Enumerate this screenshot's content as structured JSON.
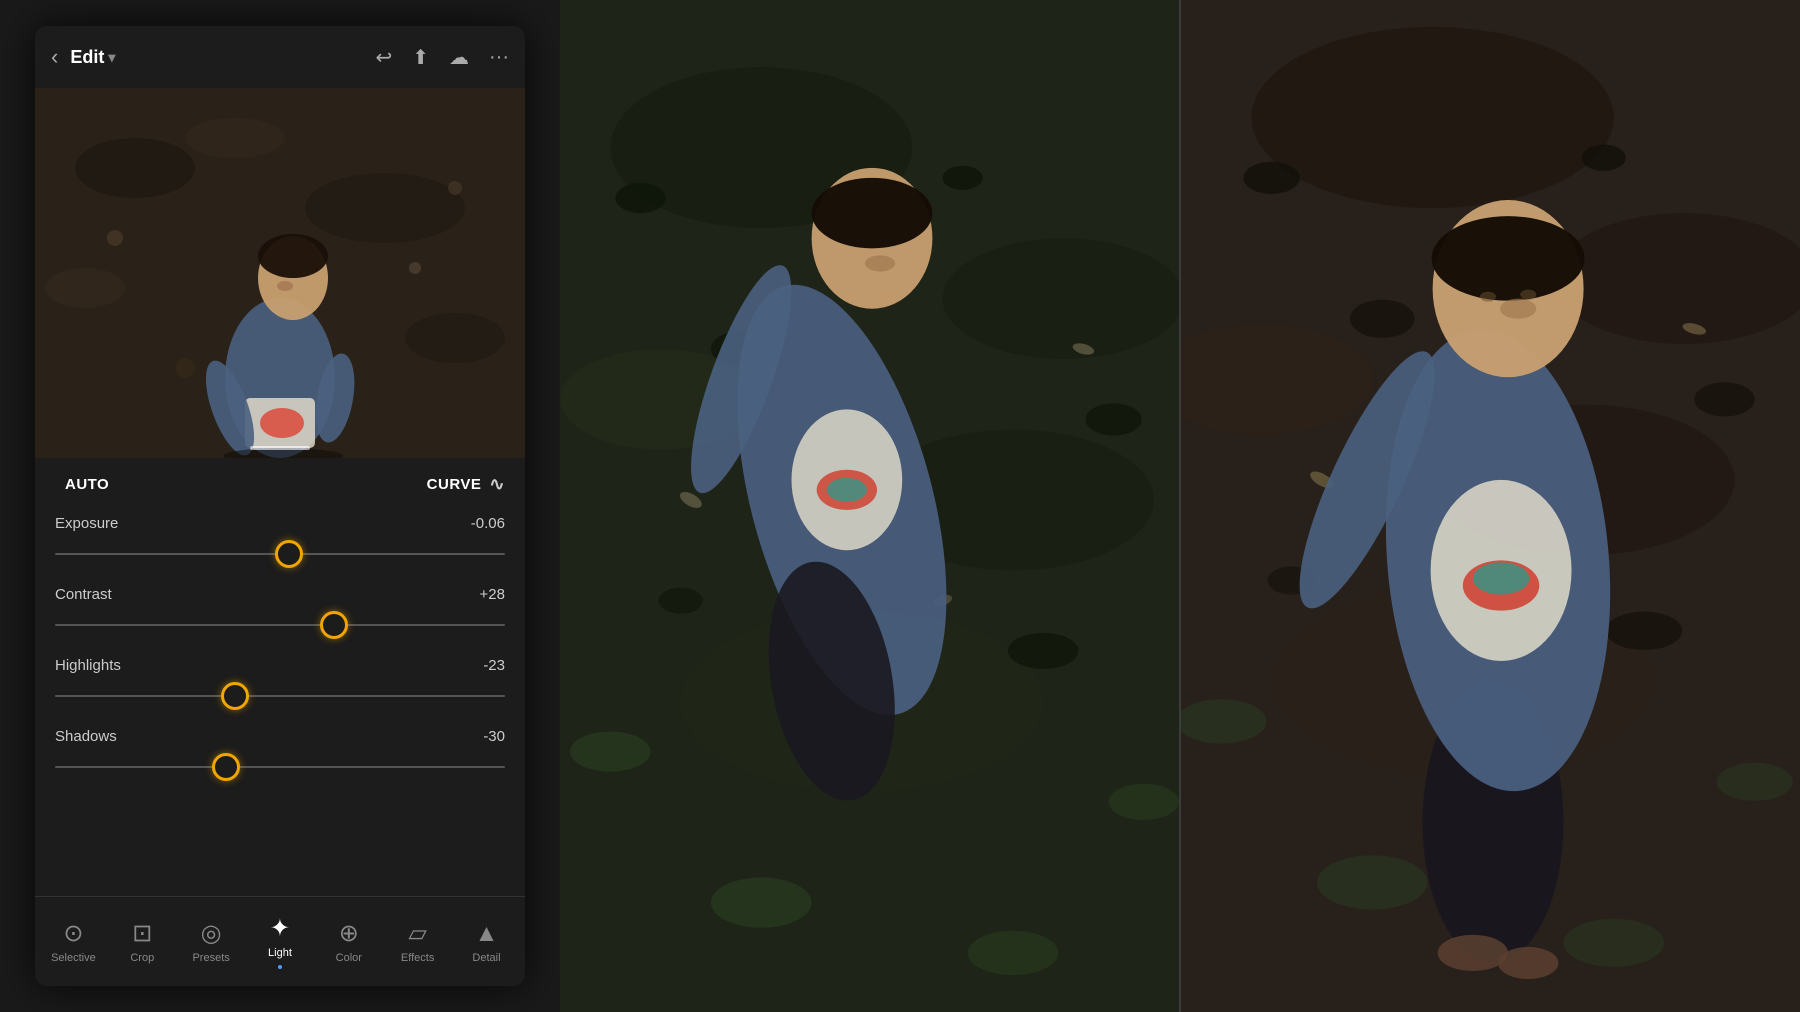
{
  "header": {
    "back_label": "‹",
    "title": "Edit",
    "title_chevron": "▾",
    "undo_icon": "↩",
    "share_icon": "⬆",
    "cloud_icon": "☁",
    "more_icon": "···"
  },
  "mode": {
    "auto_label": "AUTO",
    "curve_label": "CURVE"
  },
  "sliders": [
    {
      "label": "Exposure",
      "value": "-0.06",
      "percent": 52,
      "id": "exposure"
    },
    {
      "label": "Contrast",
      "value": "+28",
      "percent": 60,
      "id": "contrast"
    },
    {
      "label": "Highlights",
      "value": "-23",
      "percent": 42,
      "id": "highlights"
    },
    {
      "label": "Shadows",
      "value": "-30",
      "percent": 38,
      "id": "shadows"
    }
  ],
  "nav": [
    {
      "label": "Selective",
      "icon": "⊙",
      "active": false
    },
    {
      "label": "Crop",
      "icon": "⊡",
      "active": false
    },
    {
      "label": "Presets",
      "icon": "◎",
      "active": false
    },
    {
      "label": "Light",
      "icon": "✦",
      "active": true
    },
    {
      "label": "Color",
      "icon": "⊕",
      "active": false
    },
    {
      "label": "Effects",
      "icon": "▱",
      "active": false
    },
    {
      "label": "Detail",
      "icon": "▲",
      "active": false
    }
  ]
}
